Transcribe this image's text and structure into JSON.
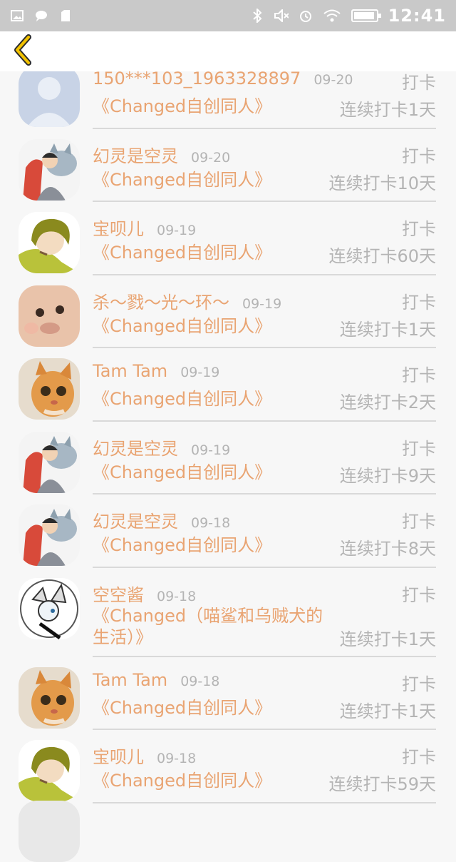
{
  "status_bar": {
    "time": "12:41",
    "icons": [
      "image-icon",
      "chat-icon",
      "sd-card-icon",
      "bluetooth-icon",
      "mute-icon",
      "alarm-icon",
      "wifi-icon",
      "battery-icon"
    ]
  },
  "nav": {
    "back_icon": "chevron-left-icon",
    "accent": "#f2c200"
  },
  "colors": {
    "accent": "#e9a472",
    "muted": "#b4b4b4",
    "divider": "#d9d9d9"
  },
  "rows": [
    {
      "name": "150***103_1963328897",
      "date": "09-20",
      "tag": "打卡",
      "book": "《Changed自创同人》",
      "streak": "连续打卡1天",
      "avatar": "default-avatar"
    },
    {
      "name": "幻灵是空灵",
      "date": "09-20",
      "tag": "打卡",
      "book": "《Changed自创同人》",
      "streak": "连续打卡10天",
      "avatar": "anime-wolf-avatar"
    },
    {
      "name": "宝呗儿",
      "date": "09-19",
      "tag": "打卡",
      "book": "《Changed自创同人》",
      "streak": "连续打卡60天",
      "avatar": "green-hair-avatar"
    },
    {
      "name": "杀～戮～光～环～",
      "date": "09-19",
      "tag": "打卡",
      "book": "《Changed自创同人》",
      "streak": "连续打卡1天",
      "avatar": "baby-face-avatar"
    },
    {
      "name": "Tam Tam",
      "date": "09-19",
      "tag": "打卡",
      "book": "《Changed自创同人》",
      "streak": "连续打卡2天",
      "avatar": "orange-cat-avatar"
    },
    {
      "name": "幻灵是空灵",
      "date": "09-19",
      "tag": "打卡",
      "book": "《Changed自创同人》",
      "streak": "连续打卡9天",
      "avatar": "anime-wolf-avatar"
    },
    {
      "name": "幻灵是空灵",
      "date": "09-18",
      "tag": "打卡",
      "book": "《Changed自创同人》",
      "streak": "连续打卡8天",
      "avatar": "anime-wolf-avatar"
    },
    {
      "name": "空空酱",
      "date": "09-18",
      "tag": "打卡",
      "book": "《Changed（喵鲨和乌贼犬的生活）》",
      "streak": "连续打卡1天",
      "avatar": "sketch-character-avatar"
    },
    {
      "name": "Tam Tam",
      "date": "09-18",
      "tag": "打卡",
      "book": "《Changed自创同人》",
      "streak": "连续打卡1天",
      "avatar": "orange-cat-avatar"
    },
    {
      "name": "宝呗儿",
      "date": "09-18",
      "tag": "打卡",
      "book": "《Changed自创同人》",
      "streak": "连续打卡59天",
      "avatar": "green-hair-avatar"
    }
  ]
}
